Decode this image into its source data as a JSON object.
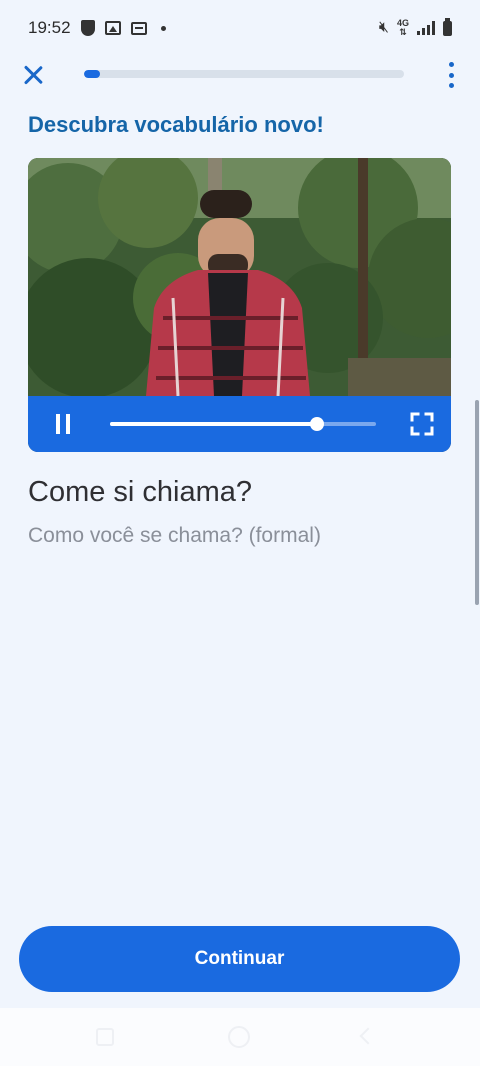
{
  "status_bar": {
    "time": "19:52",
    "left_icons": [
      "shield-icon",
      "image-icon",
      "card-icon",
      "dot-icon"
    ],
    "right_icons": [
      "mute-icon",
      "4g-icon",
      "signal-icon",
      "battery-icon"
    ],
    "network": "4G"
  },
  "top_bar": {
    "close_icon": "close-icon",
    "menu_icon": "more-vert-icon",
    "progress_fraction": 0.05
  },
  "lesson": {
    "heading": "Descubra vocabulário novo!",
    "phrase": "Come si chiama?",
    "translation": "Como você se chama? (formal)"
  },
  "video": {
    "playback_fraction": 0.78,
    "pause_icon": "pause-icon",
    "fullscreen_icon": "fullscreen-icon"
  },
  "footer": {
    "continue_label": "Continuar"
  },
  "nav_bar": {
    "icons": [
      "recents-icon",
      "home-icon",
      "back-icon"
    ]
  },
  "colors": {
    "accent": "#1a6ae0",
    "heading": "#1565a8",
    "background": "#f0f5fd"
  }
}
